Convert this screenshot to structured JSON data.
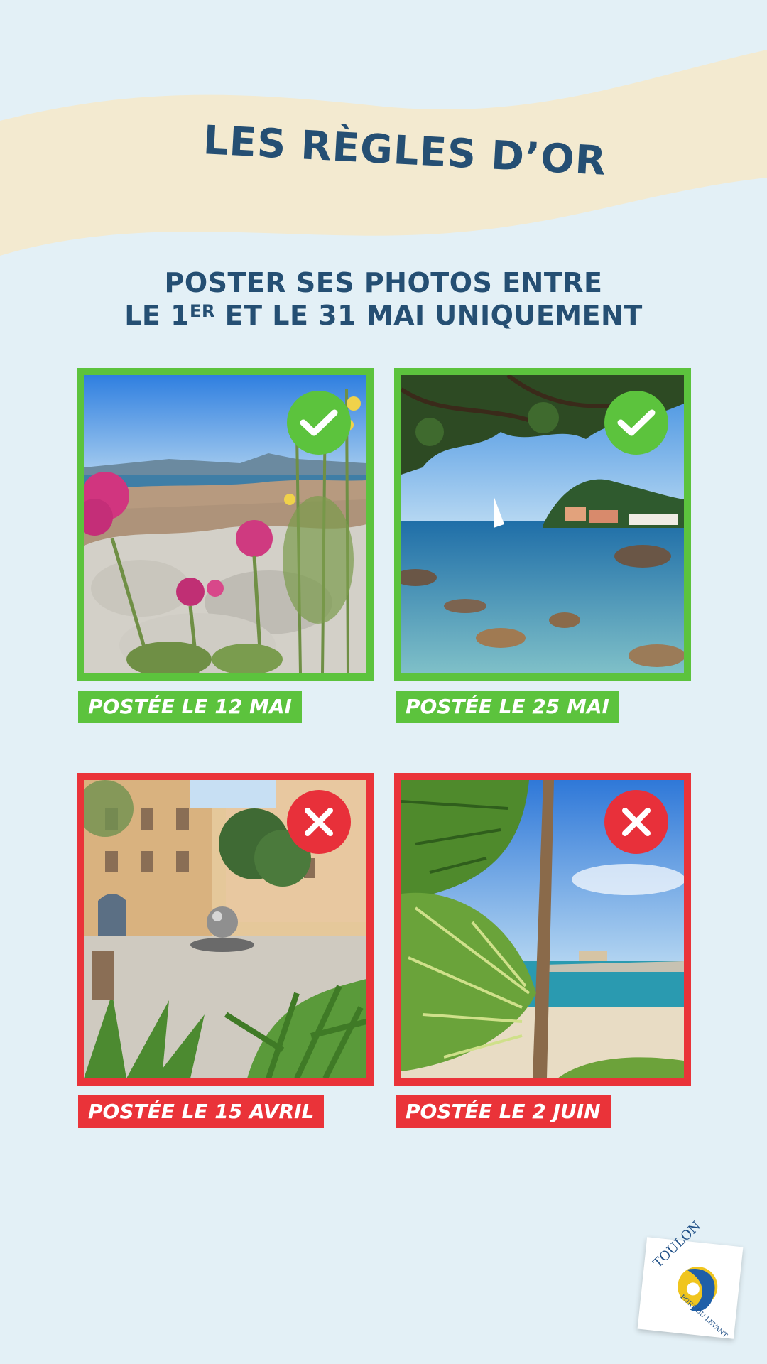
{
  "header": {
    "title": "LES RÈGLES D’OR"
  },
  "subtitle": {
    "line1": "POSTER SES PHOTOS ENTRE",
    "line2_pre": "LE 1",
    "line2_sup": "ER",
    "line2_post": " ET LE 31 MAI UNIQUEMENT"
  },
  "cards": [
    {
      "label": "POSTÉE LE 12 MAI",
      "status": "valid"
    },
    {
      "label": "POSTÉE LE 25 MAI",
      "status": "valid"
    },
    {
      "label": "POSTÉE LE 15 AVRIL",
      "status": "invalid"
    },
    {
      "label": "POSTÉE LE 2 JUIN",
      "status": "invalid"
    }
  ],
  "logo": {
    "name": "TOULON",
    "tagline": "PORT DU LEVANT"
  },
  "colors": {
    "background": "#e3f0f6",
    "banner": "#f3ead0",
    "title": "#254f73",
    "valid": "#5cc33d",
    "invalid": "#ea3339"
  },
  "icons": {
    "valid": "check-icon",
    "invalid": "cross-icon"
  }
}
